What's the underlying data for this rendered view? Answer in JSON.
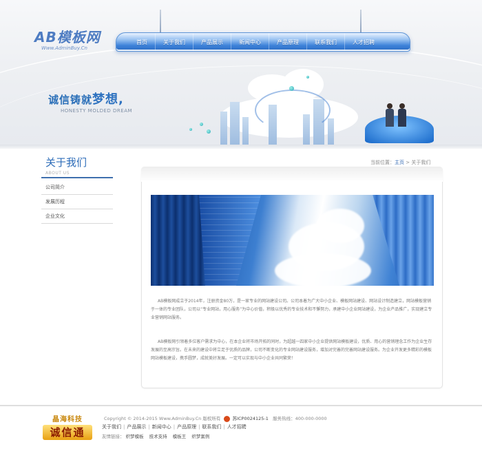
{
  "header": {
    "logo_text": "AB模板网",
    "logo_sub": "Www.AdminBuy.Cn",
    "nav": [
      "首页",
      "关于我们",
      "产品展示",
      "新闻中心",
      "产品原理",
      "联系我们",
      "人才招聘"
    ],
    "slogan_cn_a": "诚信铸就",
    "slogan_cn_b": "梦想,",
    "slogan_en": "HONESTY MOLDED DREAM"
  },
  "sidebar": {
    "title": "关于我们",
    "subtitle": "ABOUT US",
    "items": [
      "公司简介",
      "发展历程",
      "企业文化"
    ]
  },
  "breadcrumb": {
    "prefix": "当前位置：",
    "home": "主页",
    "sep": " > ",
    "current": "关于我们"
  },
  "content": {
    "paragraph_1": "AB模板网成立于2014年，注册资金80万，是一家专业的网站建设公司。公司本着为广大中小企业、模板网站建设、网站设计制造建立，网站模板营销于一体的专业团队，公司以“专业网站，用心服务”为中心价值，积极以优秀的专业技术和不懈努力，承建中小企业网站建设，为企业产品推广，实现建立专业营销网站服务。",
    "paragraph_2": "AB模板网引领着多位客户需求为中心，在本企业将市场开拓的同时，为超越一四家中小企业提供网站模板建设，优质、用心的营销理念工作为企业生存发展的至高宗旨。在未来的建设中将立足于优质的品牌，公司不断变化的专业网站建设服务，增加对完善的完善网站建设服务。为企业开发更多精彩的模板网站模板建设，携手圆梦，成就美好发展。一定可以实现与中小企业共同繁荣！"
  },
  "footer": {
    "logo_top": "晶海科技",
    "logo_bottom": "诚信通",
    "copyright": "Copyright © 2014-2015 Www.AdminBuy.Cn 版权所有",
    "icp": "苏ICP0024125-1",
    "phone": "服务热线：400-000-0000",
    "links": [
      "关于我们",
      "产品展示",
      "新闻中心",
      "产品原理",
      "联系我们",
      "人才招聘"
    ],
    "friends_label": "友情链接：",
    "friends": [
      "织梦模板",
      "技术支持",
      "模板王",
      "织梦案例"
    ]
  },
  "colors": {
    "accent": "#2d6cb8",
    "nav": "#3d82d9",
    "footer_logo": "#e8a012"
  }
}
